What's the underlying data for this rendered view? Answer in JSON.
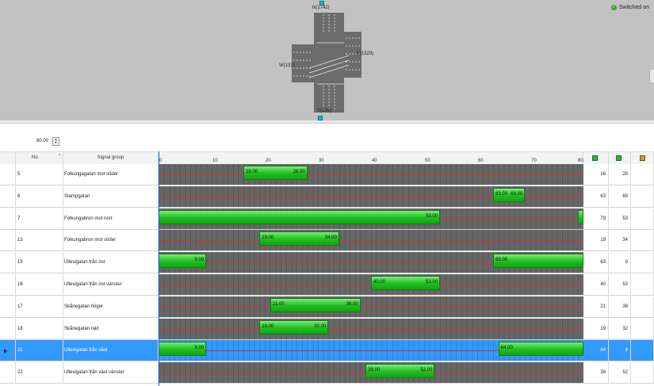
{
  "status": {
    "switched_on_label": "Switched on"
  },
  "intersection": {
    "north_label": "N(1742)",
    "south_label": "S(136)",
    "west_label": "W(131)",
    "east_label": "E(1529)"
  },
  "cycle": {
    "value": "80.00"
  },
  "header": {
    "no_label": "No",
    "signal_group_label": "Signal group",
    "ticks": [
      "0",
      "10",
      "20",
      "30",
      "40",
      "50",
      "60",
      "70",
      "80"
    ]
  },
  "rows": [
    {
      "no": "5",
      "name": "Folkungagatan mot söder",
      "start": "16",
      "end": "28",
      "bars": [
        {
          "from": 16,
          "to": 28,
          "label_start": "16.00",
          "label_end": "28.00"
        }
      ]
    },
    {
      "no": "6",
      "name": "Stampgatan",
      "start": "63",
      "end": "69",
      "bars": [
        {
          "from": 63,
          "to": 69,
          "label_start": "63.00",
          "label_end": "69.00"
        }
      ]
    },
    {
      "no": "7",
      "name": "Folkungabron mot norr",
      "start": "79",
      "end": "53",
      "bars": [
        {
          "from": 0,
          "to": 53,
          "label_start": "",
          "label_end": "53.00"
        },
        {
          "from": 79,
          "to": 80,
          "label_start": "",
          "label_end": ""
        }
      ]
    },
    {
      "no": "13",
      "name": "Folkungabron mot söder",
      "start": "19",
      "end": "34",
      "bars": [
        {
          "from": 19,
          "to": 34,
          "label_start": "19.00",
          "label_end": "34.00"
        }
      ]
    },
    {
      "no": "15",
      "name": "Ullevigatan från öst",
      "start": "63",
      "end": "9",
      "bars": [
        {
          "from": 0,
          "to": 9,
          "label_start": "",
          "label_end": "9.00"
        },
        {
          "from": 63,
          "to": 80,
          "label_start": "63.00",
          "label_end": ""
        }
      ]
    },
    {
      "no": "16",
      "name": "Ullevigatan från öst vänster",
      "start": "40",
      "end": "53",
      "bars": [
        {
          "from": 40,
          "to": 53,
          "label_start": "40.00",
          "label_end": "53.00"
        }
      ]
    },
    {
      "no": "17",
      "name": "Skånegatan höger",
      "start": "21",
      "end": "38",
      "bars": [
        {
          "from": 21,
          "to": 38,
          "label_start": "21.00",
          "label_end": "38.00"
        }
      ]
    },
    {
      "no": "18",
      "name": "Skånegatan rakt",
      "start": "19",
      "end": "32",
      "bars": [
        {
          "from": 19,
          "to": 32,
          "label_start": "19.00",
          "label_end": "32.00"
        }
      ]
    },
    {
      "no": "21",
      "name": "Ullevigatan från väst",
      "start": "64",
      "end": "9",
      "selected": true,
      "bars": [
        {
          "from": 0,
          "to": 9,
          "label_start": "",
          "label_end": "9.00"
        },
        {
          "from": 64,
          "to": 80,
          "label_start": "64.00",
          "label_end": ""
        }
      ]
    },
    {
      "no": "22",
      "name": "Ullevigatan från väst vänster",
      "start": "39",
      "end": "52",
      "bars": [
        {
          "from": 39,
          "to": 52,
          "label_start": "39.00",
          "label_end": "52.00"
        }
      ]
    }
  ],
  "timeline": {
    "max": 80
  },
  "colors": {
    "green": "#1fbf1f",
    "selected": "#3399ff",
    "redline": "#d43030"
  }
}
